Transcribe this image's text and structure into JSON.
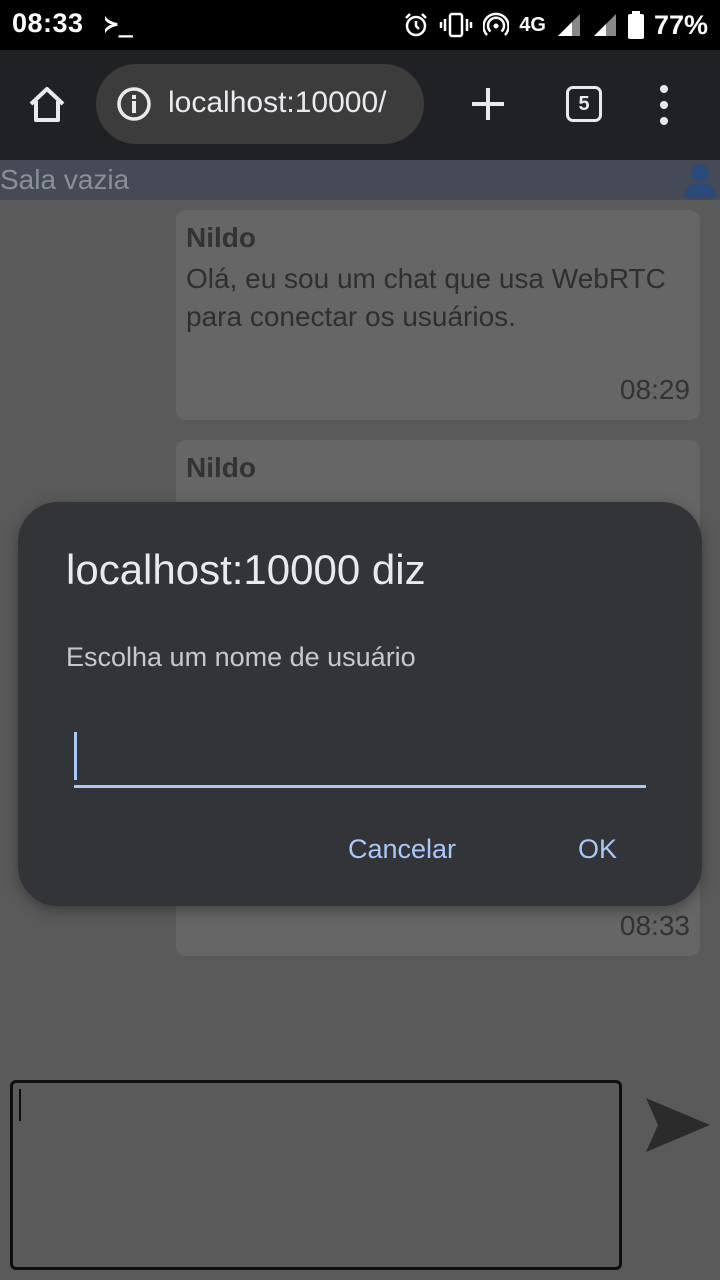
{
  "status_bar": {
    "time": "08:33",
    "terminal_glyph": "≻_",
    "network": "4G",
    "battery_percent": "77%",
    "icons": [
      "alarm-icon",
      "vibrate-icon",
      "hotspot-icon",
      "signal-icon",
      "signal-icon",
      "battery-icon"
    ]
  },
  "browser": {
    "url": "localhost:10000/",
    "tab_count": "5",
    "icons": [
      "home-icon",
      "info-icon",
      "plus-icon",
      "menu-dots-icon"
    ]
  },
  "room": {
    "title": "Sala vazia",
    "icon": "user-icon"
  },
  "messages": [
    {
      "author": "Nildo",
      "text": "Olá, eu sou um chat que usa WebRTC para conectar os usuários.",
      "time": "08:29"
    },
    {
      "author": "Nildo",
      "time": "08:33"
    }
  ],
  "composer": {
    "value": "",
    "send_icon": "send-icon"
  },
  "dialog": {
    "title": "localhost:10000 diz",
    "message": "Escolha um nome de usuário",
    "input_value": "",
    "cancel_label": "Cancelar",
    "ok_label": "OK",
    "accent_color": "#a8c7fa"
  }
}
